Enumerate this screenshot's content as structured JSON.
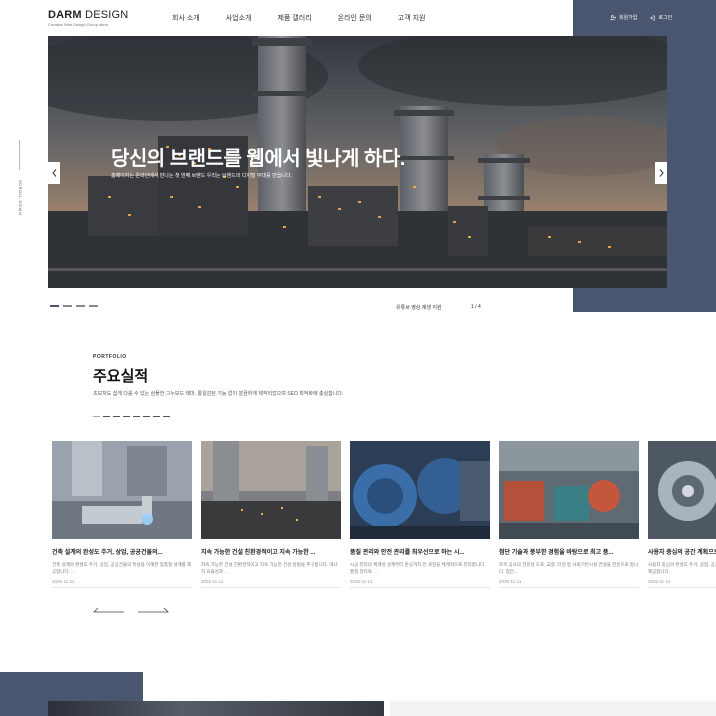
{
  "colors": {
    "navy": "#4a5570",
    "text_dark": "#222222",
    "text_muted": "#777777"
  },
  "header": {
    "logo_bold": "DARM",
    "logo_rest": " DESIGN",
    "logo_tagline": "Creative Web Design Group darm",
    "nav": [
      "회사 소개",
      "사업소개",
      "제품 갤러리",
      "온라인 문의",
      "고객 지원"
    ],
    "auth": [
      {
        "label": "회원가입",
        "icon": "user-plus-icon"
      },
      {
        "label": "로그인",
        "icon": "login-icon"
      }
    ]
  },
  "side": {
    "scroll_label": "SCROLL DOWN"
  },
  "hero": {
    "title": "당신의 브랜드를 웹에서 빛나게 하다.",
    "subtitle": "홈페이지는 온라인에서 만나는 첫 번째 브랜드 우리는 브랜드의 디지털 무대를 만듭니다.",
    "slide_label": "유튜브 영상 재생 지원",
    "slide_count": "1 / 4",
    "slide_total": 4,
    "slide_active": 1
  },
  "portfolio": {
    "eyebrow": "PORTFOLIO",
    "title": "주요실적",
    "description": "초보자도 쉽게 다룰 수 있는 심플한 그누보드 테마, 통일감된 기능 없이 깔끔하게 제작되었으며 SEO 최적화에 충실합니다.",
    "page_count": 8,
    "cards": [
      {
        "title": "건축 설계의 완성도 주거, 상업, 공공건물의...",
        "desc": "건축 설계의 완성도 주거, 상업, 공공건물의 특성을 이해한 맞춤형 설계를 제공합니다. ...",
        "date": "2025-11-11"
      },
      {
        "title": "지속 가능한 건설 친환경적이고 지속 가능한 ...",
        "desc": "지속 가능한 건설 친환경적이고 지속 가능한 건설 방법을 추구합니다. 에너지 효율성과 ...",
        "date": "2025-11-11"
      },
      {
        "title": "품질 관리와 안전 관리를 최우선으로 하는 시...",
        "desc": "시공 관리의 체계성 설계부터 준공까지 전 과정을 체계적으로 관리합니다. 품질 관리와 ...",
        "date": "2025-11-11"
      },
      {
        "title": "첨단 기술과 풍부한 경험을 바탕으로 최고 품...",
        "desc": "토목 공사의 전문성 도로, 교량, 터널 등 사회기반시설 건설을 전문으로 합니다. 첨단...",
        "date": "2025-11-11"
      },
      {
        "title": "사용자 중심의 공간 계획으로",
        "desc": "사용자 중심의 완성도 주거, 상업, 공공건물의 특성을 이해한 맞춤형 설계를 제공합니다.",
        "date": "2025-11-11"
      }
    ]
  }
}
